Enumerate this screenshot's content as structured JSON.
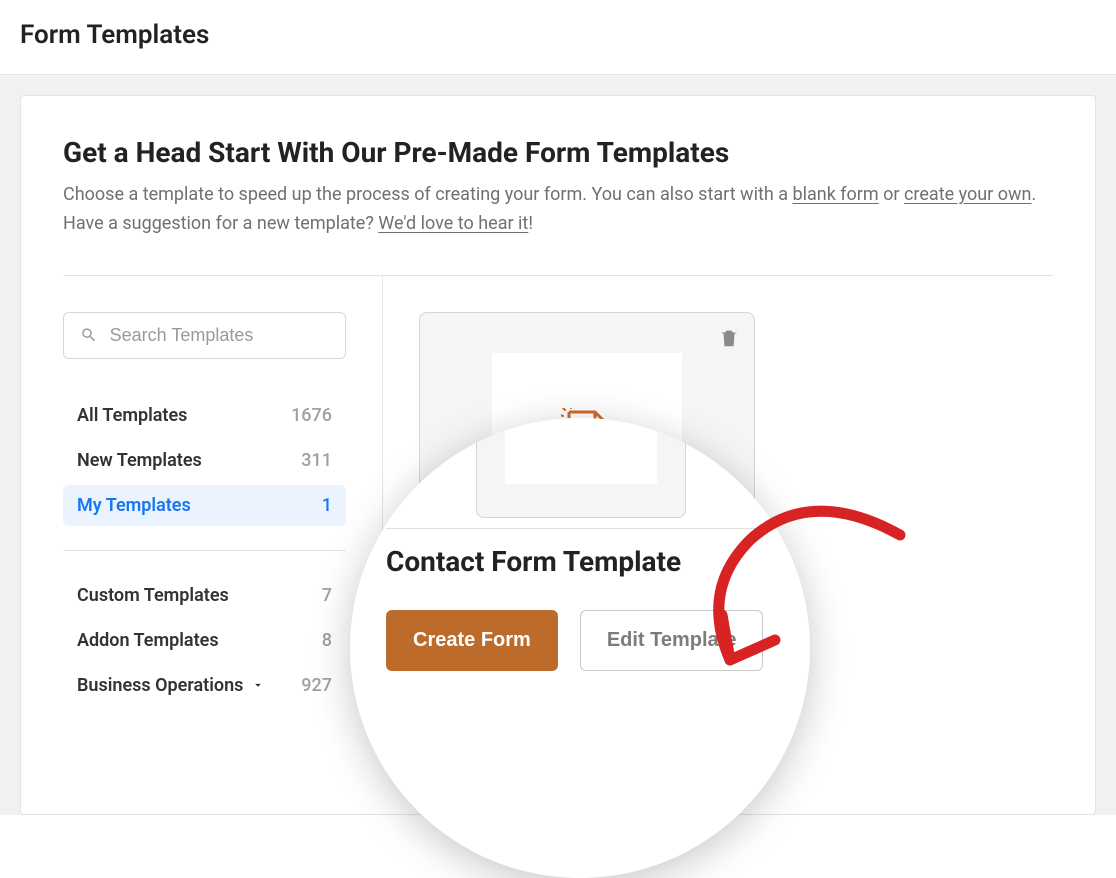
{
  "header": {
    "title": "Form Templates"
  },
  "card": {
    "heading": "Get a Head Start With Our Pre-Made Form Templates",
    "desc_part1": "Choose a template to speed up the process of creating your form. You can also start with a ",
    "link_blank": "blank form",
    "desc_part2": " or ",
    "link_create": "create your own",
    "desc_part3": ". Have a suggestion for a new template? ",
    "link_hear": "We'd love to hear it",
    "desc_part4": "!"
  },
  "search": {
    "placeholder": "Search Templates"
  },
  "categories": {
    "primary": [
      {
        "label": "All Templates",
        "count": "1676"
      },
      {
        "label": "New Templates",
        "count": "311"
      },
      {
        "label": "My Templates",
        "count": "1",
        "active": true
      }
    ],
    "secondary": [
      {
        "label": "Custom Templates",
        "count": "7"
      },
      {
        "label": "Addon Templates",
        "count": "8"
      },
      {
        "label": "Business Operations",
        "count": "927",
        "expandable": true
      }
    ]
  },
  "template": {
    "title": "Contact Form Template",
    "create_btn": "Create Form",
    "edit_btn": "Edit Template"
  }
}
